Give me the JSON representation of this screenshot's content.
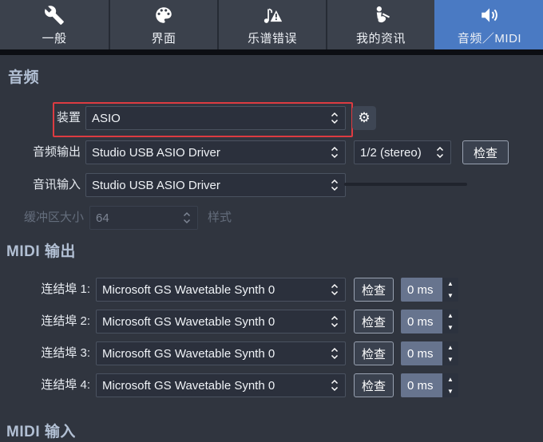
{
  "tabs": [
    {
      "label": "一般",
      "icon": "wrench-icon"
    },
    {
      "label": "界面",
      "icon": "palette-icon"
    },
    {
      "label": "乐谱错误",
      "icon": "score-error-icon"
    },
    {
      "label": "我的资讯",
      "icon": "my-info-icon"
    },
    {
      "label": "音频／MIDI",
      "icon": "speaker-icon",
      "selected": true
    }
  ],
  "audio": {
    "section_title": "音频",
    "device": {
      "label": "装置",
      "value": "ASIO"
    },
    "output": {
      "label": "音频输出",
      "driver": "Studio USB ASIO Driver",
      "channels": "1/2 (stereo)",
      "check_label": "检查"
    },
    "input": {
      "label": "音讯输入",
      "driver": "Studio USB ASIO Driver"
    },
    "buffer": {
      "label": "缓冲区大小",
      "value": "64",
      "unit": "样式",
      "disabled": true
    }
  },
  "midi_output": {
    "section_title": "MIDI 输出",
    "check_label": "检查",
    "ports": [
      {
        "label": "连结埠 1:",
        "device": "Microsoft GS Wavetable Synth 0",
        "latency": "0 ms"
      },
      {
        "label": "连结埠 2:",
        "device": "Microsoft GS Wavetable Synth 0",
        "latency": "0 ms"
      },
      {
        "label": "连结埠 3:",
        "device": "Microsoft GS Wavetable Synth 0",
        "latency": "0 ms"
      },
      {
        "label": "连结埠 4:",
        "device": "Microsoft GS Wavetable Synth 0",
        "latency": "0 ms"
      }
    ]
  },
  "midi_input": {
    "section_title": "MIDI 输入"
  },
  "icons": {
    "gear_glyph": "⚙",
    "spin_up_glyph": "▲",
    "spin_down_glyph": "▼"
  },
  "colors": {
    "tab_selected_blue": "#4a7ac3",
    "device_highlight_red": "#dd3b41",
    "background": "#30353f"
  }
}
